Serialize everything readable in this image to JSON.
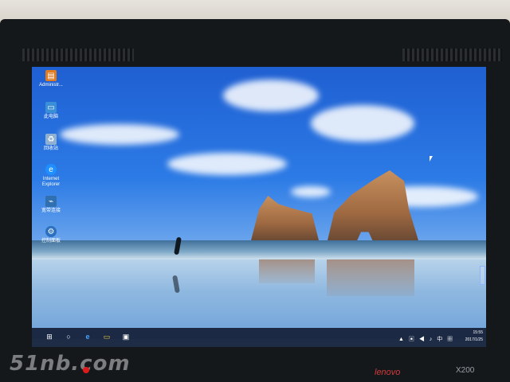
{
  "desktop": {
    "icons": [
      {
        "label": "Administr...",
        "icon": "user-folder-icon",
        "color": "#e07b22"
      },
      {
        "label": "此电脑",
        "icon": "computer-icon",
        "color": "#3a8fd6"
      },
      {
        "label": "回收站",
        "icon": "recycle-bin-icon",
        "color": "#8fb0d0"
      },
      {
        "label": "Internet Explorer",
        "icon": "internet-explorer-icon",
        "color": "#1e90ff"
      },
      {
        "label": "宽带连接",
        "icon": "network-connection-icon",
        "color": "#3070b0"
      },
      {
        "label": "控制面板",
        "icon": "control-panel-icon",
        "color": "#2a6fc0"
      }
    ]
  },
  "taskbar": {
    "items": [
      {
        "name": "start-icon",
        "glyph": "⊞"
      },
      {
        "name": "search-icon",
        "glyph": "○"
      },
      {
        "name": "edge-icon",
        "glyph": "e"
      },
      {
        "name": "file-explorer-icon",
        "glyph": "▭"
      },
      {
        "name": "store-icon",
        "glyph": "▣"
      }
    ],
    "tray_icons": "▲ ▣ ◀ ♪ 中 ▦",
    "time": "15:55",
    "date": "2017/1/25"
  },
  "bezel": {
    "brand": "lenovo",
    "model": "X200"
  },
  "watermark": "51nb.com"
}
